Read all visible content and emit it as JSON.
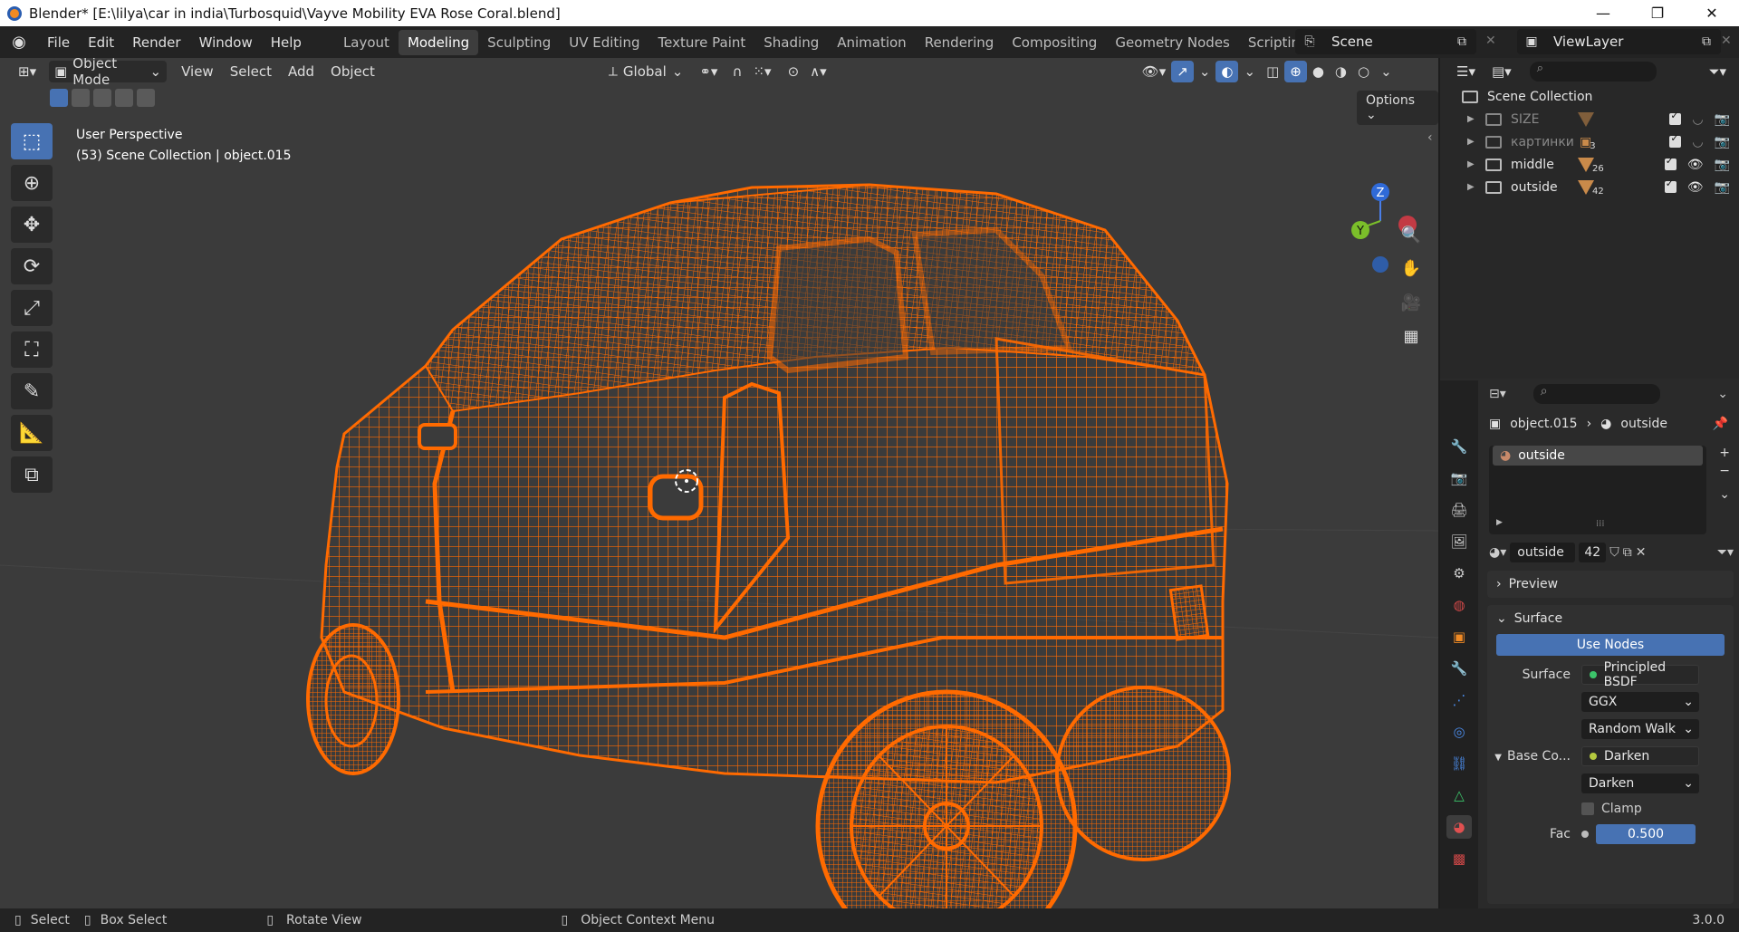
{
  "window": {
    "title": "Blender* [E:\\lilya\\car in india\\Turbosquid\\Vayve Mobility EVA Rose Coral.blend]",
    "minimize": "—",
    "maximize": "❐",
    "close": "✕"
  },
  "menu": [
    "File",
    "Edit",
    "Render",
    "Window",
    "Help"
  ],
  "workspaces": [
    "Layout",
    "Modeling",
    "Sculpting",
    "UV Editing",
    "Texture Paint",
    "Shading",
    "Animation",
    "Rendering",
    "Compositing",
    "Geometry Nodes",
    "Scripting"
  ],
  "active_workspace": "Modeling",
  "scene": {
    "name": "Scene",
    "view_layer": "ViewLayer"
  },
  "viewport_header": {
    "mode": "Object Mode",
    "menus": [
      "View",
      "Select",
      "Add",
      "Object"
    ],
    "orientation": "Global",
    "options": "Options"
  },
  "viewport_info": {
    "line1": "User Perspective",
    "line2": "(53) Scene Collection | object.015"
  },
  "gizmo": {
    "z": "Z",
    "y": "Y"
  },
  "outliner": {
    "root": "Scene Collection",
    "items": [
      {
        "name": "SIZE",
        "count": "",
        "dim": true
      },
      {
        "name": "картинки",
        "count": "3",
        "dim": true
      },
      {
        "name": "middle",
        "count": "26",
        "dim": false
      },
      {
        "name": "outside",
        "count": "42",
        "dim": false
      }
    ]
  },
  "properties": {
    "breadcrumb_object": "object.015",
    "breadcrumb_material": "outside",
    "slot": "outside",
    "material_name": "outside",
    "users": "42",
    "preview": "Preview",
    "surface_panel": "Surface",
    "use_nodes": "Use Nodes",
    "surface_label": "Surface",
    "surface_value": "Principled BSDF",
    "distribution": "GGX",
    "subsurface": "Random Walk",
    "base_color_label": "Base Co...",
    "base_color_value": "Darken",
    "blend": "Darken",
    "clamp": "Clamp",
    "fac_label": "Fac",
    "fac_value": "0.500"
  },
  "statusbar": {
    "select": "Select",
    "box_select": "Box Select",
    "rotate": "Rotate View",
    "context": "Object Context Menu",
    "version": "3.0.0"
  },
  "colors": {
    "wire": "#ff6a00",
    "accent": "#4772b3",
    "viewport": "#3b3b3b"
  }
}
